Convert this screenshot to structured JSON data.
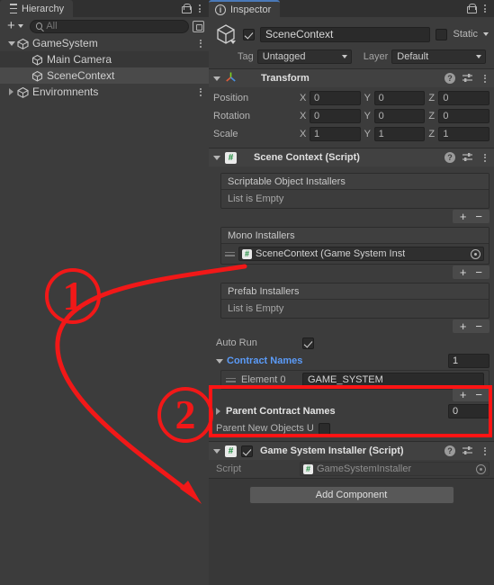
{
  "hierarchy": {
    "tab_label": "Hierarchy",
    "tab_icon": "hierarchy-icon",
    "lock_icon": "lock-icon",
    "menu_icon": "kebab-menu-icon",
    "toolbar": {
      "create_label": "+",
      "create_dropdown_icon": "chevron-down-icon",
      "search_icon": "search-icon",
      "search_value": "",
      "search_placeholder": "All",
      "select_mode_icon": "selection-icon"
    },
    "rows": [
      {
        "label": "GameSystem",
        "icon": "unity-prefab-icon",
        "indent": 1,
        "expander": "down",
        "menu": true,
        "state": "alt"
      },
      {
        "label": "Main Camera",
        "icon": "gameobject-cube-icon",
        "indent": 2,
        "expander": "none",
        "menu": false,
        "state": "dark"
      },
      {
        "label": "SceneContext",
        "icon": "gameobject-cube-icon",
        "indent": 2,
        "expander": "none",
        "menu": false,
        "state": "sel"
      },
      {
        "label": "Enviromnents",
        "icon": "unity-prefab-icon",
        "indent": 1,
        "expander": "right",
        "menu": true,
        "state": "alt"
      }
    ]
  },
  "inspector": {
    "tab_label": "Inspector",
    "tab_icon": "info-icon",
    "lock_icon": "lock-icon",
    "menu_icon": "kebab-menu-icon",
    "object_header": {
      "gameobject_icon": "gameobject-cube-icon",
      "enabled": true,
      "name": "SceneContext",
      "static_checked": false,
      "static_label": "Static",
      "static_dropdown_icon": "chevron-down-icon",
      "tag_label": "Tag",
      "tag_value": "Untagged",
      "layer_label": "Layer",
      "layer_value": "Default"
    },
    "transform": {
      "title": "Transform",
      "icon": "transform-axis-icon",
      "expander": "down",
      "help_icon": "help-icon",
      "preset_icon": "preset-icon",
      "menu_icon": "kebab-menu-icon",
      "rows": [
        {
          "label": "Position",
          "x": "0",
          "y": "0",
          "z": "0"
        },
        {
          "label": "Rotation",
          "x": "0",
          "y": "0",
          "z": "0"
        },
        {
          "label": "Scale",
          "x": "1",
          "y": "1",
          "z": "1"
        }
      ],
      "axis_labels": [
        "X",
        "Y",
        "Z"
      ]
    },
    "scene_context": {
      "title": "Scene Context (Script)",
      "icon": "csharp-script-icon",
      "expander": "down",
      "help_icon": "help-icon",
      "preset_icon": "preset-icon",
      "menu_icon": "kebab-menu-icon",
      "lists": [
        {
          "header": "Scriptable Object Installers",
          "empty_text": "List is Empty",
          "items": [],
          "add_label": "+",
          "remove_label": "−"
        },
        {
          "header": "Mono Installers",
          "empty_text": "",
          "items": [
            {
              "icon": "csharp-script-icon",
              "text": "SceneContext (Game System Inst",
              "picker_icon": "object-picker-icon"
            }
          ],
          "add_label": "+",
          "remove_label": "−"
        },
        {
          "header": "Prefab Installers",
          "empty_text": "List is Empty",
          "items": [],
          "add_label": "+",
          "remove_label": "−"
        }
      ],
      "auto_run": {
        "label": "Auto Run",
        "checked": true
      },
      "contract_names": {
        "label": "Contract Names",
        "expander": "down",
        "size": "1",
        "elements": [
          {
            "label": "Element 0",
            "value": "GAME_SYSTEM"
          }
        ],
        "add_label": "+",
        "remove_label": "−"
      },
      "parent_contract_names": {
        "label": "Parent Contract Names",
        "expander": "right",
        "size": "0"
      },
      "parent_new_objects": {
        "label": "Parent New Objects U",
        "checked": false
      }
    },
    "installer": {
      "title": "Game System Installer (Script)",
      "icon": "csharp-script-icon",
      "expander": "down",
      "enabled": true,
      "help_icon": "help-icon",
      "preset_icon": "preset-icon",
      "menu_icon": "kebab-menu-icon",
      "script_label": "Script",
      "script_value": "GameSystemInstaller",
      "script_icon": "csharp-script-icon",
      "picker_icon": "object-picker-icon"
    },
    "add_component_label": "Add Component"
  },
  "annotations": {
    "accent_color": "#ff1414",
    "markers": [
      {
        "number": "①_one",
        "text": "1"
      },
      {
        "number": "②_two",
        "text": "2"
      }
    ],
    "arrow": "curved-red-arrow",
    "highlight_boxes": 1
  },
  "colors": {
    "panel_bg": "#3c3c3c",
    "window_bg": "#383838",
    "tab_bar": "#303030",
    "accent_blue": "#4a79b8",
    "prop_blue": "#5b9bf8",
    "annotation_red": "#ff1414"
  }
}
